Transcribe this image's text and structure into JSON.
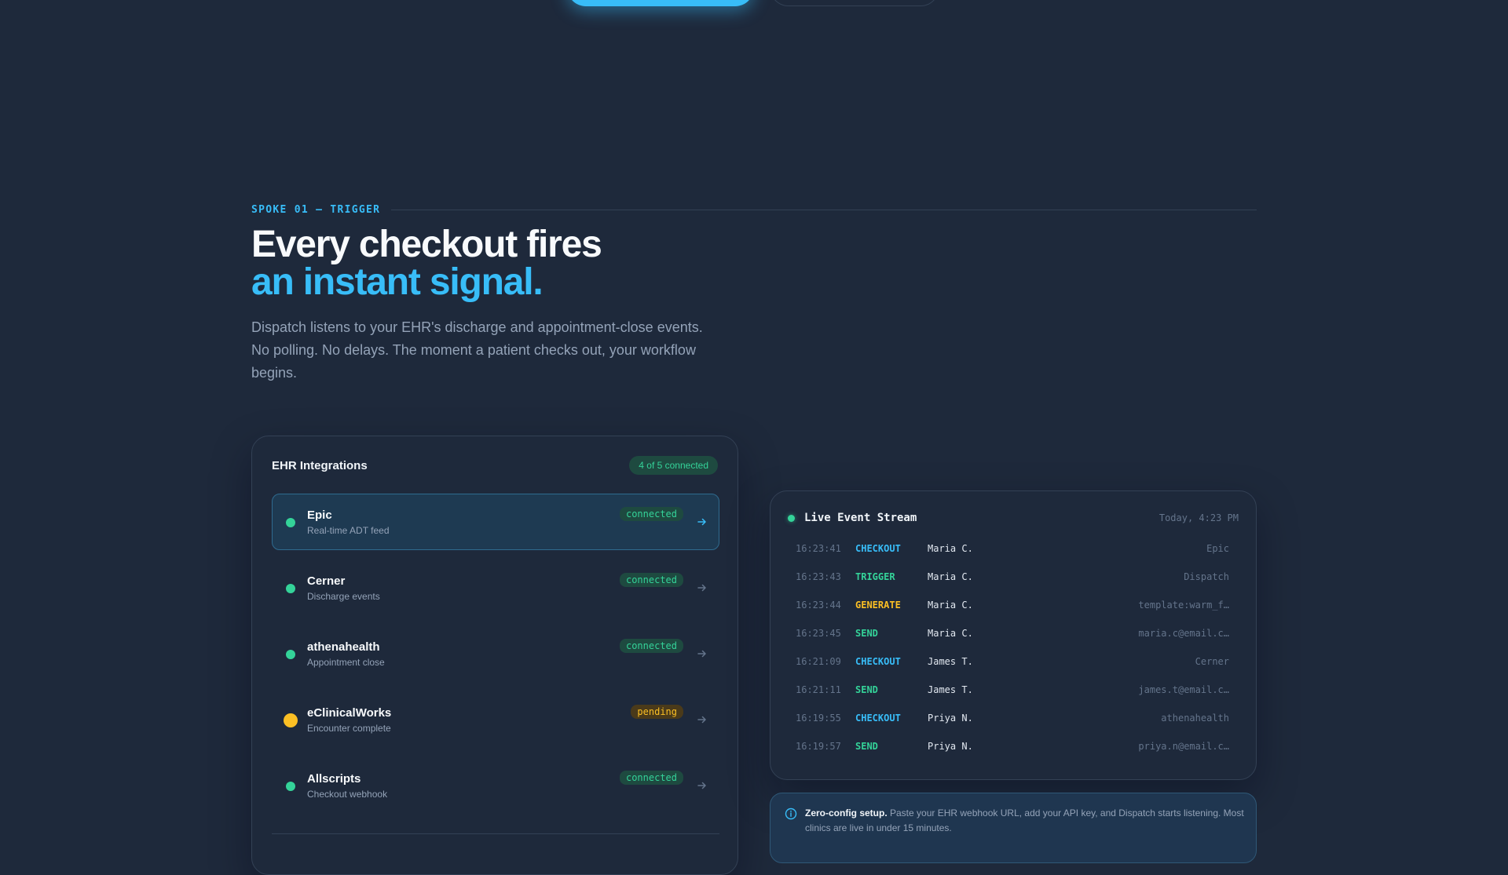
{
  "eyebrow": "SPOKE 01 — TRIGGER",
  "headline": {
    "line1": "Every checkout fires",
    "line2": "an instant signal."
  },
  "lede": "Dispatch listens to your EHR's discharge and appointment-close events. No polling. No delays. The moment a patient checks out, your workflow begins.",
  "ehr": {
    "title": "EHR Integrations",
    "count": "4 of 5 connected",
    "items": [
      {
        "name": "Epic",
        "desc": "Real-time ADT feed",
        "status": "connected",
        "active": true
      },
      {
        "name": "Cerner",
        "desc": "Discharge events",
        "status": "connected",
        "active": false
      },
      {
        "name": "athenahealth",
        "desc": "Appointment close",
        "status": "connected",
        "active": false
      },
      {
        "name": "eClinicalWorks",
        "desc": "Encounter complete",
        "status": "pending",
        "active": false
      },
      {
        "name": "Allscripts",
        "desc": "Checkout webhook",
        "status": "connected",
        "active": false
      }
    ]
  },
  "stream": {
    "title": "Live Event Stream",
    "time": "Today, 4:23 PM",
    "events": [
      {
        "time": "16:23:41",
        "type": "CHECKOUT",
        "patient": "Maria C.",
        "target": "Epic"
      },
      {
        "time": "16:23:43",
        "type": "TRIGGER",
        "patient": "Maria C.",
        "target": "Dispatch"
      },
      {
        "time": "16:23:44",
        "type": "GENERATE",
        "patient": "Maria C.",
        "target": "template:warm_f…"
      },
      {
        "time": "16:23:45",
        "type": "SEND",
        "patient": "Maria C.",
        "target": "maria.c@email.c…"
      },
      {
        "time": "16:21:09",
        "type": "CHECKOUT",
        "patient": "James T.",
        "target": "Cerner"
      },
      {
        "time": "16:21:11",
        "type": "SEND",
        "patient": "James T.",
        "target": "james.t@email.c…"
      },
      {
        "time": "16:19:55",
        "type": "CHECKOUT",
        "patient": "Priya N.",
        "target": "athenahealth"
      },
      {
        "time": "16:19:57",
        "type": "SEND",
        "patient": "Priya N.",
        "target": "priya.n@email.c…"
      }
    ]
  },
  "note": {
    "bold": "Zero-config setup.",
    "text": " Paste your EHR webhook URL, add your API key, and Dispatch starts listening. Most clinics are live in under 15 minutes."
  },
  "colors": {
    "background": "#1e293b",
    "accent": "#38bdf8",
    "success": "#34d399",
    "warning": "#fbbf24",
    "muted": "#94a3b8"
  },
  "icons": {
    "row_arrow": "arrow-right-icon",
    "info": "info-icon",
    "live": "live-dot-icon"
  }
}
